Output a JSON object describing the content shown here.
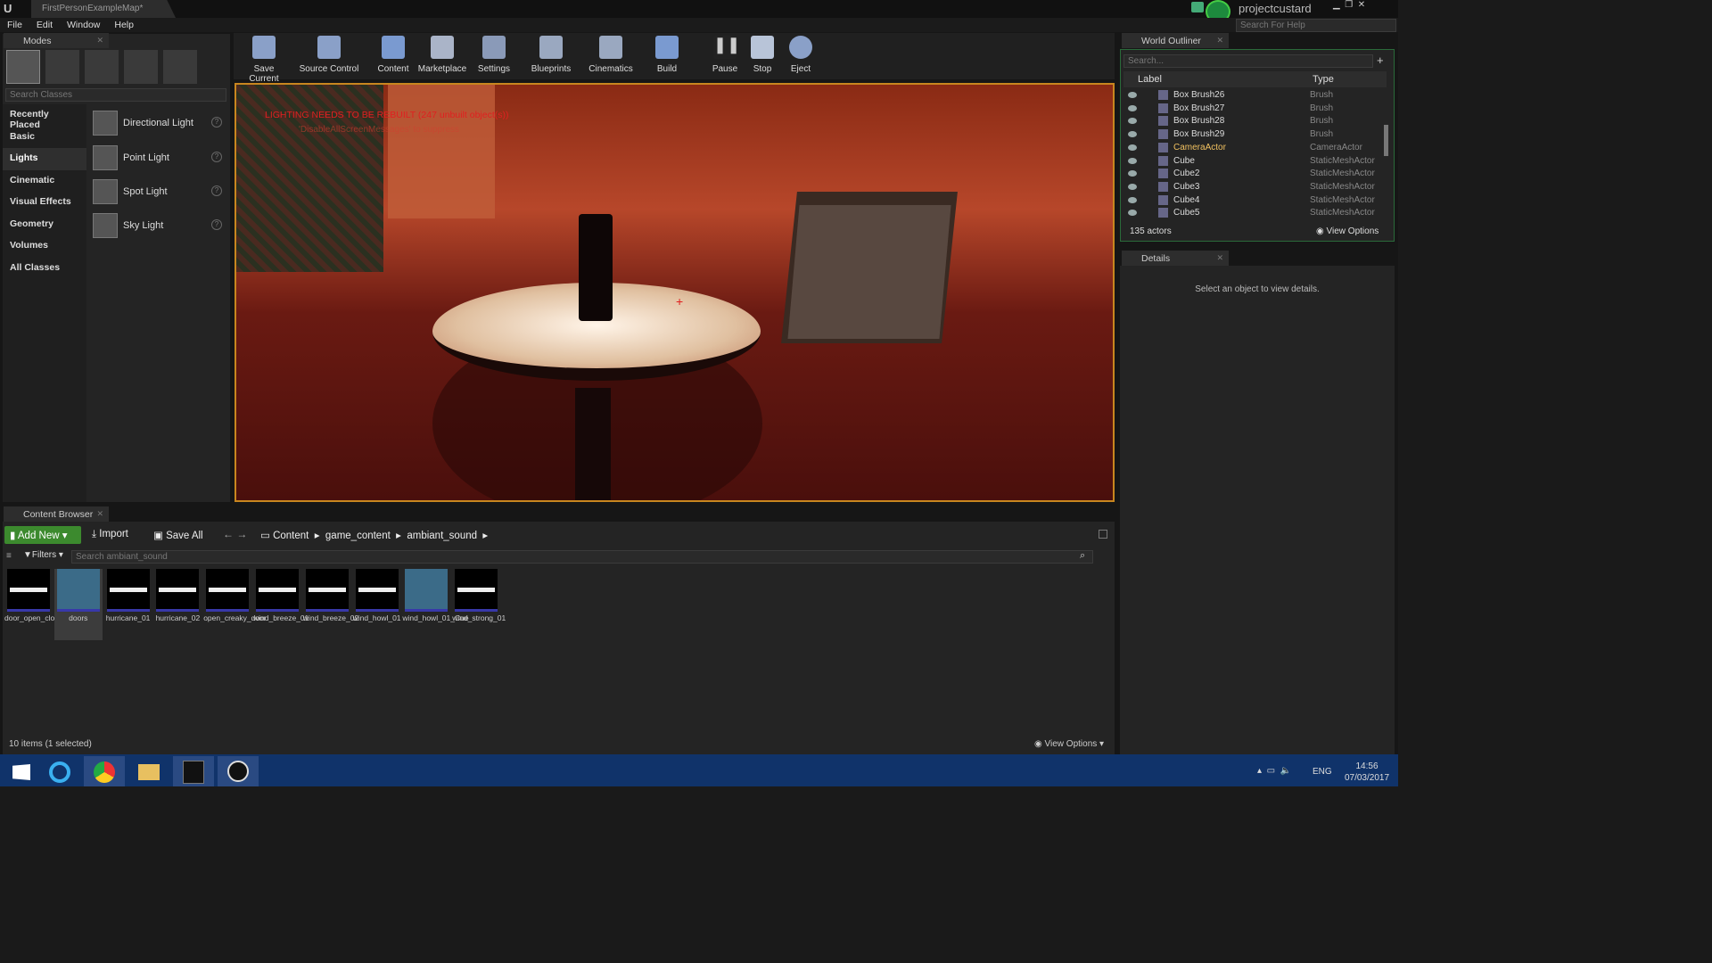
{
  "window": {
    "tab": "FirstPersonExampleMap*",
    "project": "projectcustard",
    "help_search": "Search For Help"
  },
  "menu": [
    "File",
    "Edit",
    "Window",
    "Help"
  ],
  "modes": {
    "tab": "Modes",
    "search": "Search Classes",
    "categories": [
      "Recently Placed",
      "Basic",
      "Lights",
      "Cinematic",
      "Visual Effects",
      "Geometry",
      "Volumes",
      "All Classes"
    ],
    "items": [
      "Directional Light",
      "Point Light",
      "Spot Light",
      "Sky Light"
    ]
  },
  "toolbar": [
    "Save Current",
    "Source Control",
    "Content",
    "Marketplace",
    "Settings",
    "Blueprints",
    "Cinematics",
    "Build",
    "Pause",
    "Stop",
    "Eject"
  ],
  "viewport": {
    "warning": "LIGHTING NEEDS TO BE REBUILT (247 unbuilt object(s))",
    "sub": "'DisableAllScreenMessages' to suppress"
  },
  "outliner": {
    "tab": "World Outliner",
    "search": "Search...",
    "col_label": "Label",
    "col_type": "Type",
    "rows": [
      [
        "Box Brush26",
        "Brush"
      ],
      [
        "Box Brush27",
        "Brush"
      ],
      [
        "Box Brush28",
        "Brush"
      ],
      [
        "Box Brush29",
        "Brush"
      ],
      [
        "CameraActor",
        "CameraActor"
      ],
      [
        "Cube",
        "StaticMeshActor"
      ],
      [
        "Cube2",
        "StaticMeshActor"
      ],
      [
        "Cube3",
        "StaticMeshActor"
      ],
      [
        "Cube4",
        "StaticMeshActor"
      ],
      [
        "Cube5",
        "StaticMeshActor"
      ]
    ],
    "count": "135 actors",
    "view_options": "View Options"
  },
  "details": {
    "tab": "Details",
    "empty": "Select an object to view details."
  },
  "content": {
    "tab": "Content Browser",
    "add_new": "Add New",
    "import": "Import",
    "save_all": "Save All",
    "path": [
      "Content",
      "game_content",
      "ambiant_sound"
    ],
    "filters": "Filters",
    "search": "Search ambiant_sound",
    "assets": [
      "door_open_close",
      "doors",
      "hurricane_01",
      "hurricane_02",
      "open_creaky_door",
      "wind_breeze_01",
      "wind_breeze_02",
      "wind_howl_01",
      "wind_howl_01_Cue",
      "wind_strong_01"
    ],
    "status": "10 items (1 selected)",
    "view_options": "View Options"
  },
  "taskbar": {
    "lang": "ENG",
    "time": "14:56",
    "date": "07/03/2017"
  }
}
